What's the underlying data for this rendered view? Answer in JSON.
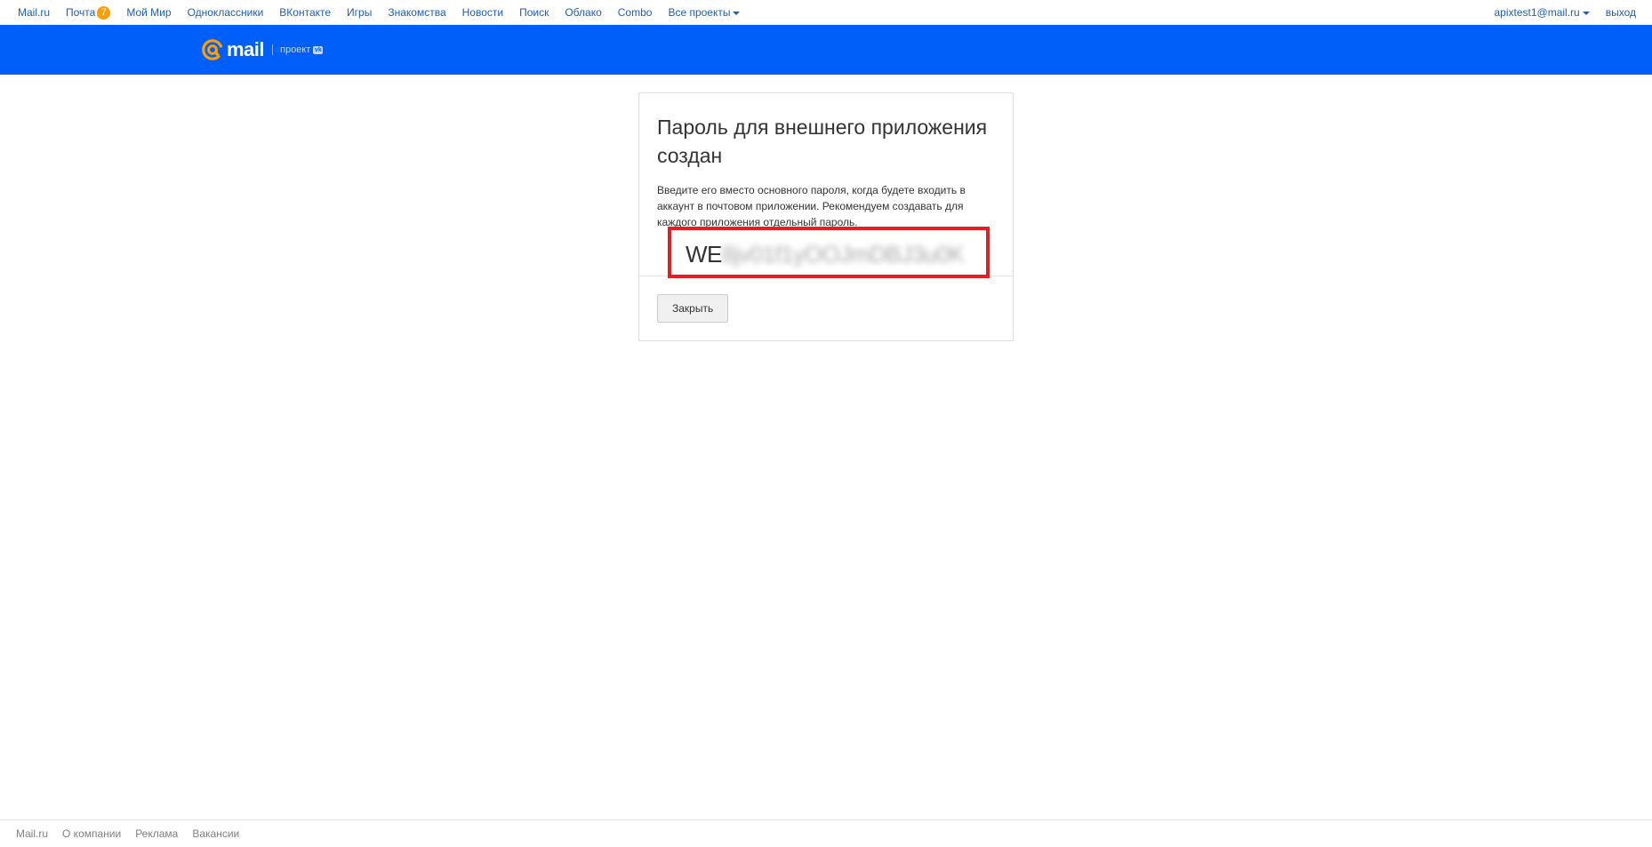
{
  "portal_nav": {
    "links": [
      {
        "label": "Mail.ru"
      },
      {
        "label": "Почта",
        "badge": "7"
      },
      {
        "label": "Мой Мир"
      },
      {
        "label": "Одноклассники"
      },
      {
        "label": "ВКонтакте"
      },
      {
        "label": "Игры"
      },
      {
        "label": "Знакомства"
      },
      {
        "label": "Новости"
      },
      {
        "label": "Поиск"
      },
      {
        "label": "Облако"
      },
      {
        "label": "Combo"
      },
      {
        "label": "Все проекты",
        "icon": "chevron-down-icon"
      }
    ],
    "user_email": "apixtest1@mail.ru",
    "logout_label": "выход"
  },
  "header": {
    "logo_word": "mail",
    "project_label": "проект",
    "vk_badge": "vk",
    "colors": {
      "background": "#005ff9",
      "logo_at": "#ff9e00"
    }
  },
  "dialog": {
    "title": "Пароль для внешнего приложения создан",
    "description": "Введите его вместо основного пароля, когда будете входить в аккаунт в почтовом приложении. Рекомендуем создавать для каждого приложения отдельный пароль.",
    "password_visible": "WE",
    "password_hidden": "8jv01f1yOOJmDBJ3u0K",
    "highlight_color": "#e31e24",
    "close_label": "Закрыть"
  },
  "footer": {
    "links": [
      {
        "label": "Mail.ru"
      },
      {
        "label": "О компании"
      },
      {
        "label": "Реклама"
      },
      {
        "label": "Вакансии"
      }
    ]
  }
}
